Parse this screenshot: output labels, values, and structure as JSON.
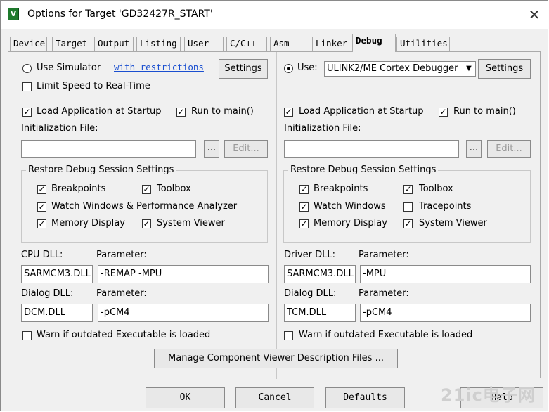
{
  "window": {
    "title": "Options for Target 'GD32427R_START'"
  },
  "tabs": [
    "Device",
    "Target",
    "Output",
    "Listing",
    "User",
    "C/C++",
    "Asm",
    "Linker",
    "Debug",
    "Utilities"
  ],
  "active_tab": "Debug",
  "left": {
    "use_simulator_label": "Use Simulator",
    "restrictions_link": "with restrictions",
    "settings_label": "Settings",
    "limit_speed_label": "Limit Speed to Real-Time",
    "load_app_label": "Load Application at Startup",
    "run_to_main_label": "Run to main()",
    "init_file_label": "Initialization File:",
    "init_file_value": "",
    "browse_label": "...",
    "edit_label": "Edit...",
    "restore_group_title": "Restore Debug Session Settings",
    "breakpoints_label": "Breakpoints",
    "toolbox_label": "Toolbox",
    "watch_label": "Watch Windows & Performance Analyzer",
    "memory_label": "Memory Display",
    "system_viewer_label": "System Viewer",
    "cpu_dll_label": "CPU DLL:",
    "cpu_dll_value": "SARMCM3.DLL",
    "cpu_param_label": "Parameter:",
    "cpu_param_value": "-REMAP -MPU",
    "dialog_dll_label": "Dialog DLL:",
    "dialog_dll_value": "DCM.DLL",
    "dialog_param_label": "Parameter:",
    "dialog_param_value": "-pCM4",
    "warn_label": "Warn if outdated Executable is loaded"
  },
  "right": {
    "use_label": "Use:",
    "debugger_value": "ULINK2/ME Cortex Debugger",
    "settings_label": "Settings",
    "load_app_label": "Load Application at Startup",
    "run_to_main_label": "Run to main()",
    "init_file_label": "Initialization File:",
    "init_file_value": "",
    "browse_label": "...",
    "edit_label": "Edit...",
    "restore_group_title": "Restore Debug Session Settings",
    "breakpoints_label": "Breakpoints",
    "toolbox_label": "Toolbox",
    "watch_label": "Watch Windows",
    "tracepoints_label": "Tracepoints",
    "memory_label": "Memory Display",
    "system_viewer_label": "System Viewer",
    "driver_dll_label": "Driver DLL:",
    "driver_dll_value": "SARMCM3.DLL",
    "driver_param_label": "Parameter:",
    "driver_param_value": "-MPU",
    "dialog_dll_label": "Dialog DLL:",
    "dialog_dll_value": "TCM.DLL",
    "dialog_param_label": "Parameter:",
    "dialog_param_value": "-pCM4",
    "warn_label": "Warn if outdated Executable is loaded"
  },
  "manage_button": "Manage Component Viewer Description Files ...",
  "buttons": {
    "ok": "OK",
    "cancel": "Cancel",
    "defaults": "Defaults",
    "help": "Help"
  },
  "watermark": "21ic电子网",
  "state": {
    "use_simulator": false,
    "use_target": true,
    "left_limit_speed": false,
    "left_load_app": true,
    "left_run_to_main": true,
    "left_breakpoints": true,
    "left_toolbox": true,
    "left_watch": true,
    "left_memory": true,
    "left_system_viewer": true,
    "left_warn": false,
    "right_load_app": true,
    "right_run_to_main": true,
    "right_breakpoints": true,
    "right_toolbox": true,
    "right_watch": true,
    "right_tracepoints": false,
    "right_memory": true,
    "right_system_viewer": true,
    "right_warn": false
  }
}
